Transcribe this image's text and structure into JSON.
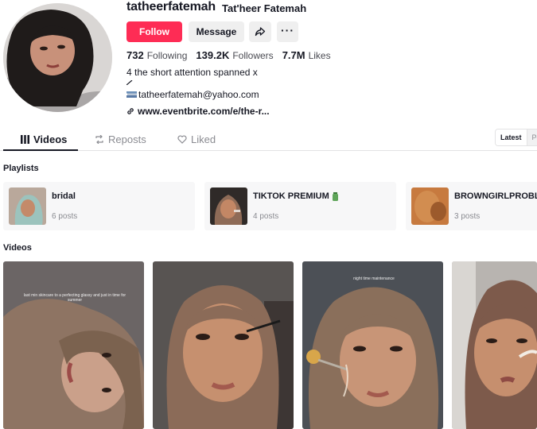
{
  "profile": {
    "username": "tatheerfatemah",
    "nickname": "Tat'heer Fatemah",
    "follow_label": "Follow",
    "message_label": "Message",
    "more_label": "···",
    "stats": [
      {
        "value": "732",
        "label": "Following"
      },
      {
        "value": "139.2K",
        "label": "Followers"
      },
      {
        "value": "7.7M",
        "label": "Likes"
      }
    ],
    "bio_line": "4 the short attention spanned x",
    "bio_email": "tatheerfatemah@yahoo.com",
    "bio_link": "www.eventbrite.com/e/the-r..."
  },
  "tabs": {
    "videos": "Videos",
    "reposts": "Reposts",
    "liked": "Liked"
  },
  "sort": {
    "latest": "Latest",
    "popular": "Po"
  },
  "sections": {
    "playlists": "Playlists",
    "videos": "Videos"
  },
  "playlists": [
    {
      "name": "bridal",
      "count": "6 posts"
    },
    {
      "name": "TIKTOK PREMIUM",
      "count": "4 posts"
    },
    {
      "name": "BROWNGIRLPROBLE",
      "count": "3 posts"
    }
  ],
  "videos": [
    {
      "caption": "last min skincare to a perfecting glassy and just in time for summer"
    },
    {
      "caption": ""
    },
    {
      "caption": "night time maintenance"
    },
    {
      "caption": ""
    }
  ],
  "colors": {
    "accent": "#fe2c55",
    "text": "#161823",
    "muted": "#8a8b91",
    "hijab_brown": "#7a5a48",
    "skin": "#c98f6b"
  }
}
